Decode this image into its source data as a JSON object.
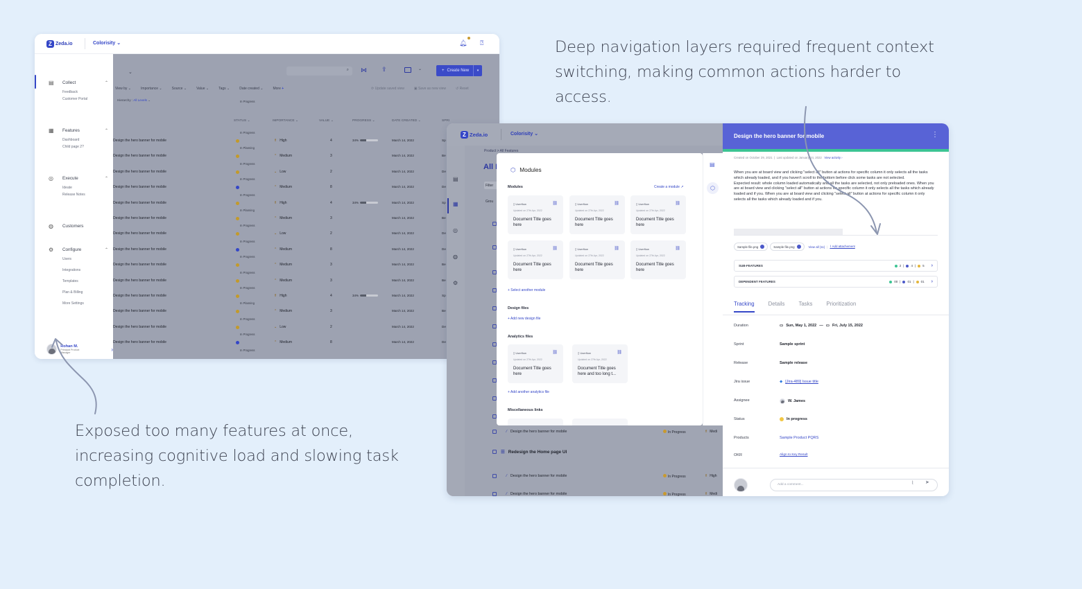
{
  "captions": {
    "top": "Deep navigation layers required frequent context switching, making common actions harder to access.",
    "bottom": "Exposed too many features at once, increasing cognitive load and slowing task completion."
  },
  "colors": {
    "accent": "#3446c7",
    "background": "#e3effb",
    "header": "#5863d6",
    "success": "#3cc493"
  },
  "screen1": {
    "brand": "Zeda.io",
    "workspace": "Colorisity",
    "nav": [
      {
        "label": "Collect",
        "icon": "inbox-icon",
        "items": [
          "Feedback",
          "Customer Portal"
        ]
      },
      {
        "label": "Features",
        "icon": "clipboard-icon",
        "items": [
          "Dashboard",
          "Child page 2?"
        ]
      },
      {
        "label": "Execute",
        "icon": "check-circle-icon",
        "items": [
          "Ideate",
          "Release Notes"
        ]
      },
      {
        "label": "Customers",
        "icon": "users-icon",
        "items": []
      },
      {
        "label": "Configure",
        "icon": "gear-icon",
        "items": [
          "Users",
          "Integrations",
          "Templates",
          "Plan & Billing",
          "More Settings"
        ]
      }
    ],
    "user": {
      "name": "Rohan M.",
      "role": "Principal Product Manager"
    },
    "create_button": "Create New",
    "filters": [
      "View by",
      "Importance",
      "Source",
      "Value",
      "Tags",
      "Date created",
      "More"
    ],
    "filter_actions": [
      "Update saved view",
      "Save as new view",
      "Reset"
    ],
    "hierarchy_label": "Hierarchy :",
    "hierarchy_value": "All Levels",
    "columns": [
      "STATUS",
      "IMPORTANCE",
      "VALUE",
      "PROGRESS",
      "DATE CREATED",
      "SPRI"
    ],
    "first_status": "In Progress",
    "rows": [
      {
        "name": "Design the hero banner for mobile",
        "status": "In Progress",
        "dot": "#c39a2a",
        "importance": "High",
        "value": "4",
        "progress": "34%",
        "progress_fill": 0.34,
        "date": "March 14, 2022",
        "sprint": "Sp"
      },
      {
        "name": "Design the hero banner for mobile",
        "status": "In Planning",
        "dot": "#c39a2a",
        "importance": "Medium",
        "value": "3",
        "progress": "",
        "progress_fill": null,
        "date": "March 14, 2022",
        "sprint": "Be"
      },
      {
        "name": "Design the hero banner for mobile",
        "status": "In Progress",
        "dot": "#c39a2a",
        "importance": "Low",
        "value": "2",
        "progress": "",
        "progress_fill": null,
        "date": "March 14, 2022",
        "sprint": "De"
      },
      {
        "name": "Design the hero banner for mobile",
        "status": "In Progress",
        "dot": "#3446c7",
        "importance": "Medium",
        "value": "8",
        "progress": "",
        "progress_fill": null,
        "date": "March 14, 2022",
        "sprint": "De"
      },
      {
        "name": "Design the hero banner for mobile",
        "status": "In Progress",
        "dot": "#c39a2a",
        "importance": "High",
        "value": "4",
        "progress": "34%",
        "progress_fill": 0.34,
        "date": "March 14, 2022",
        "sprint": "Sp"
      },
      {
        "name": "Design the hero banner for mobile",
        "status": "In Planning",
        "dot": "#c39a2a",
        "importance": "Medium",
        "value": "3",
        "progress": "",
        "progress_fill": null,
        "date": "March 14, 2022",
        "sprint": "Be"
      },
      {
        "name": "Design the hero banner for mobile",
        "status": "In Progress",
        "dot": "#c39a2a",
        "importance": "Low",
        "value": "2",
        "progress": "",
        "progress_fill": null,
        "date": "March 14, 2022",
        "sprint": "De"
      },
      {
        "name": "Design the hero banner for mobile",
        "status": "In Progress",
        "dot": "#3446c7",
        "importance": "Medium",
        "value": "8",
        "progress": "",
        "progress_fill": null,
        "date": "March 14, 2022",
        "sprint": "De"
      },
      {
        "name": "Design the hero banner for mobile",
        "status": "In Progress",
        "dot": "#c39a2a",
        "importance": "Medium",
        "value": "3",
        "progress": "",
        "progress_fill": null,
        "date": "March 14, 2022",
        "sprint": "Be"
      },
      {
        "name": "Design the hero banner for mobile",
        "status": "In Progress",
        "dot": "#c39a2a",
        "importance": "Medium",
        "value": "3",
        "progress": "",
        "progress_fill": null,
        "date": "March 14, 2022",
        "sprint": "Be"
      },
      {
        "name": "Design the hero banner for mobile",
        "status": "In Progress",
        "dot": "#c39a2a",
        "importance": "High",
        "value": "4",
        "progress": "34%",
        "progress_fill": 0.34,
        "date": "March 14, 2022",
        "sprint": "Sp"
      },
      {
        "name": "Design the hero banner for mobile",
        "status": "In Planning",
        "dot": "#c39a2a",
        "importance": "Medium",
        "value": "3",
        "progress": "",
        "progress_fill": null,
        "date": "March 14, 2022",
        "sprint": "Be"
      },
      {
        "name": "Design the hero banner for mobile",
        "status": "In Progress",
        "dot": "#c39a2a",
        "importance": "Low",
        "value": "2",
        "progress": "",
        "progress_fill": null,
        "date": "March 14, 2022",
        "sprint": "De"
      },
      {
        "name": "Design the hero banner for mobile",
        "status": "In Progress",
        "dot": "#3446c7",
        "importance": "Medium",
        "value": "8",
        "progress": "",
        "progress_fill": null,
        "date": "March 14, 2022",
        "sprint": "De"
      }
    ],
    "last_status": "In Progress"
  },
  "screen2": {
    "brand": "Zeda.io",
    "workspace": "Colorisity",
    "breadcrumb": "Product > All Features",
    "page_title": "All F",
    "filter_stub": "Filter",
    "group_stub": "Grou",
    "bg_rows": [
      {
        "name": "Design the hero banner for mobile",
        "status": "In Progress",
        "imp": "Medi",
        "group": false
      },
      {
        "name": "Redesign the Home page UI",
        "status": "",
        "imp": "",
        "group": true
      },
      {
        "name": "Design the hero banner for mobile",
        "status": "In Progress",
        "imp": "High",
        "group": false
      },
      {
        "name": "Design the hero banner for mobile",
        "status": "In Progress",
        "imp": "Medi",
        "group": false
      }
    ],
    "modules": {
      "title": "Modules",
      "modules_label": "Modules",
      "create_link": "Create a module",
      "cards": [
        {
          "type": "Userflow",
          "updated": "Updated on 27th Apr, 2022",
          "title": "Document Title goes here"
        },
        {
          "type": "Userflow",
          "updated": "Updated on 27th Apr, 2022",
          "title": "Document Title goes here"
        },
        {
          "type": "Userflow",
          "updated": "Updated on 27th Apr, 2022",
          "title": "Document Title goes here"
        },
        {
          "type": "Userflow",
          "updated": "Updated on 27th Apr, 2022",
          "title": "Document Title goes here"
        },
        {
          "type": "Userflow",
          "updated": "Updated on 27th Apr, 2022",
          "title": "Document Title goes here"
        },
        {
          "type": "Userflow",
          "updated": "Updated on 27th Apr, 2022",
          "title": "Document Title goes here"
        }
      ],
      "select_another": "+ Select another module",
      "design_label": "Design files",
      "design_add": "+ Add new design file",
      "analytics_label": "Analytics files",
      "analytics_cards": [
        {
          "type": "Userflow",
          "updated": "Updated on 27th Apr, 2022",
          "title": "Document Title goes here"
        },
        {
          "type": "Userflow",
          "updated": "Updated on 27th Apr, 2022",
          "title": "Document Title goes here and too long t..."
        }
      ],
      "analytics_add": "+ Add another analytics file",
      "misc_label": "Miscellaneous links"
    },
    "detail": {
      "title": "Design the hero banner for mobile",
      "created": "Created on October 29, 2021",
      "updated": "Last updated on January 24, 2022",
      "view_activity": "View activity",
      "description": "When you are at board view and clicking \"select all\" button at actions for specific column it only selects all the tasks which already loaded, and if you haven't scroll to the bottom before click some tasks are not selected.\nExpected result: whole column loaded automatically and all the tasks are selected, not only preloaded ones. When you are at board view and clicking \"select all\" button at actions for specific column it only selects all the tasks which already loaded and if you. When you are at board view and clicking \"select all\" button at actions for specific column it only selects all the tasks which already loaded and if you.",
      "attachments": [
        "Sample file.png",
        "Sample file.png"
      ],
      "view_all": "View all (11)",
      "add_attachment": "Add attachement",
      "sub_features": {
        "label": "SUB-FEATURES",
        "counts": [
          "2",
          "4",
          "5"
        ]
      },
      "dependent_features": {
        "label": "DEPENDENT FEATURES",
        "counts": [
          "00",
          "01",
          "01"
        ]
      },
      "tabs": [
        "Tracking",
        "Details",
        "Tasks",
        "Prioritization"
      ],
      "fields": [
        {
          "label": "Duration",
          "value": "Sun, May 1, 2022",
          "value2": "Fri, July 15, 2022"
        },
        {
          "label": "Sprint",
          "value": "Sample sprint"
        },
        {
          "label": "Release",
          "value": "Sample release"
        },
        {
          "label": "Jira issue",
          "value": "[Jira-489] Issue title"
        },
        {
          "label": "Assignee",
          "value": "W. James"
        },
        {
          "label": "Status",
          "value": "In progress"
        },
        {
          "label": "Products",
          "value": "Sample Product PQRS"
        },
        {
          "label": "OKR",
          "value": "Align to Key Result"
        }
      ],
      "comment_placeholder": "Add a comment..."
    }
  }
}
